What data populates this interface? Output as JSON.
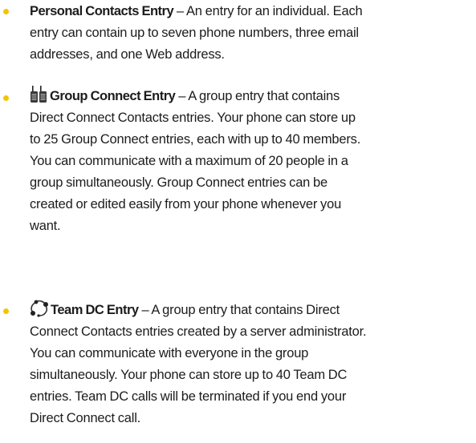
{
  "colors": {
    "bullet": "#f2c500",
    "text": "#1c1c1c"
  },
  "entries": [
    {
      "icon": null,
      "title": "Personal Contacts Entry",
      "sep": " – ",
      "lines": [
        "An entry for an individual. Each",
        "entry can contain up to seven phone numbers, three email",
        "addresses, and one Web address."
      ]
    },
    {
      "icon": "group-connect-icon",
      "title": "Group Connect Entry",
      "sep": " – ",
      "lines": [
        "A group entry that contains",
        "Direct Connect Contacts entries. Your phone can store up",
        "to 25 Group Connect entries, each with up to 40 members.",
        "You can communicate with a maximum of 20 people in a",
        "group simultaneously. Group Connect entries can be",
        "created or edited easily from your phone whenever you",
        "want."
      ]
    },
    {
      "icon": "team-dc-icon",
      "title": "Team DC Entry",
      "sep": " – ",
      "lines": [
        "A group entry that contains Direct",
        "Connect Contacts entries created by a server administrator.",
        "You can communicate with everyone in the group",
        "simultaneously. Your phone can store up to 40 Team DC",
        "entries. Team DC calls will be terminated if you end your",
        "Direct Connect call."
      ]
    }
  ]
}
